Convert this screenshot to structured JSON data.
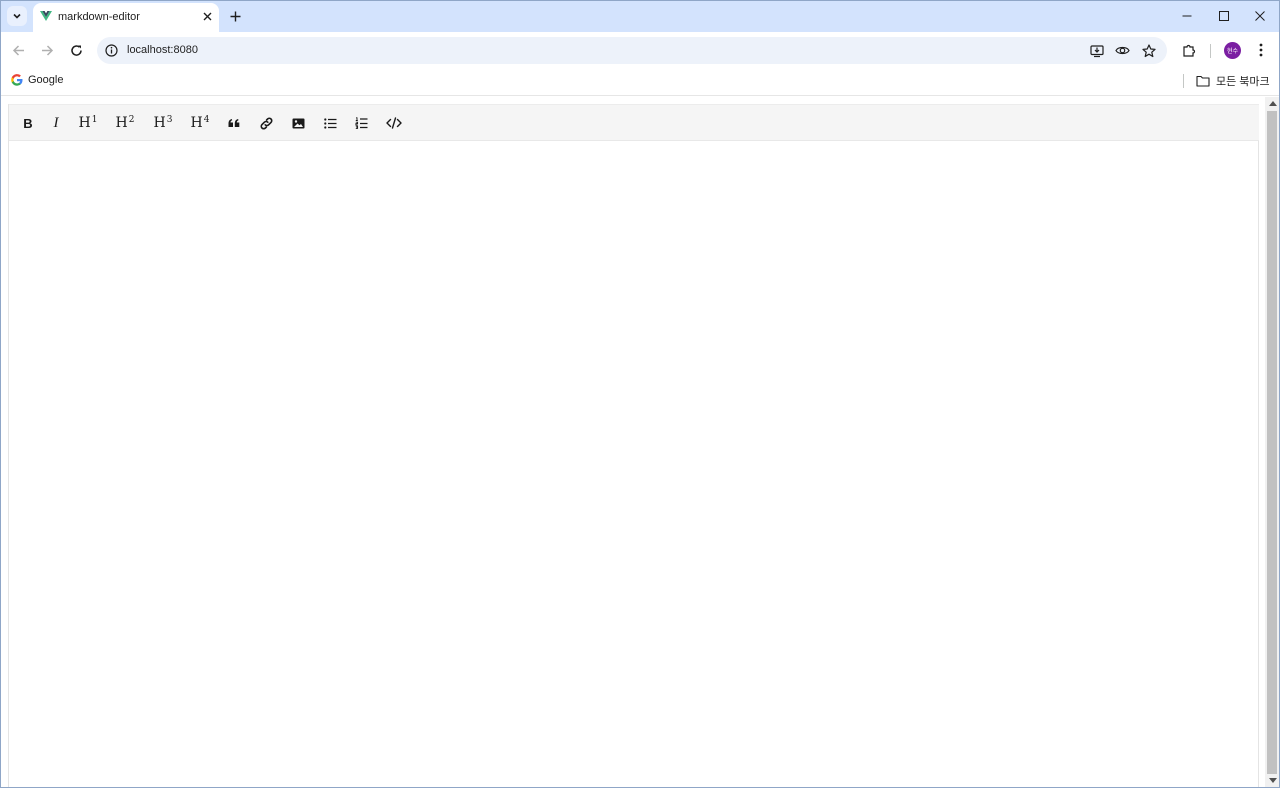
{
  "browser": {
    "tab": {
      "title": "markdown-editor"
    },
    "address": {
      "url": "localhost:8080"
    },
    "profile": {
      "initials": "현수"
    },
    "bookmarks": {
      "items": [
        {
          "label": "Google"
        }
      ],
      "all_bookmarks_label": "모든 북마크"
    }
  },
  "editor": {
    "toolbar": {
      "bold": "B",
      "italic": "I",
      "h1": {
        "base": "H",
        "level": "1"
      },
      "h2": {
        "base": "H",
        "level": "2"
      },
      "h3": {
        "base": "H",
        "level": "3"
      },
      "h4": {
        "base": "H",
        "level": "4"
      }
    },
    "content": ""
  },
  "colors": {
    "tabstrip": "#d3e3fd",
    "omnibox": "#edf2fa",
    "avatar": "#7b1fa2",
    "editor_toolbar": "#f5f5f5"
  }
}
